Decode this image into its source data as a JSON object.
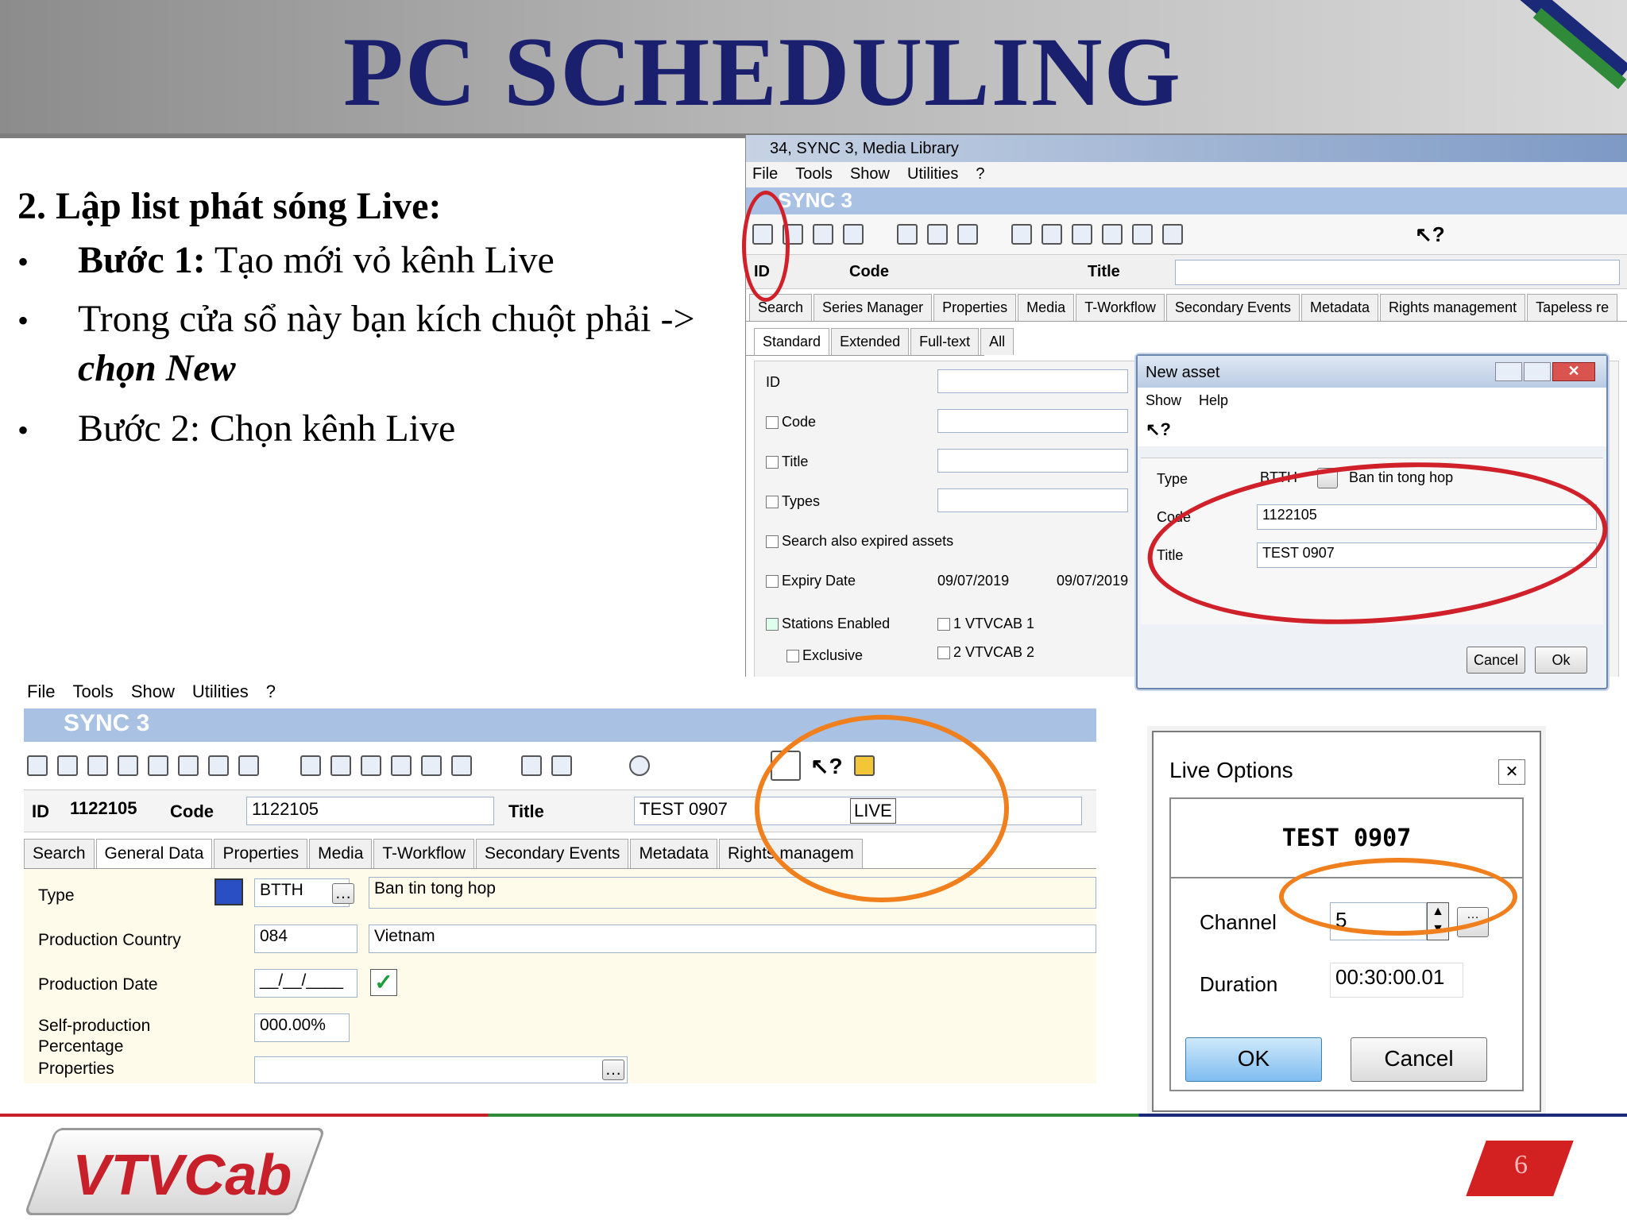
{
  "slide": {
    "title": "PC SCHEDULING",
    "heading": "2. Lập list phát sóng Live:",
    "bullets": [
      {
        "bold": "Bước 1:",
        "text": " Tạo mới vỏ kênh Live"
      },
      {
        "line1": "Trong cửa sổ này bạn kích chuột phải ->",
        "line2": "chọn New"
      },
      {
        "text": "Bước 2: Chọn kênh Live"
      }
    ],
    "page_number": "6",
    "logo_text": "VTVCab"
  },
  "win1": {
    "title": "34, SYNC 3, Media Library",
    "menu": [
      "File",
      "Tools",
      "Show",
      "Utilities",
      "?"
    ],
    "brand": "SYNC 3",
    "header": {
      "id": "ID",
      "code": "Code",
      "title": "Title"
    },
    "tabs": [
      "Search",
      "Series Manager",
      "Properties",
      "Media",
      "T-Workflow",
      "Secondary Events",
      "Metadata",
      "Rights management",
      "Tapeless re"
    ],
    "subtabs": [
      "Standard",
      "Extended",
      "Full-text",
      "All"
    ],
    "fields": {
      "id": "ID",
      "code": "Code",
      "title": "Title",
      "types": "Types",
      "search_expired": "Search also expired assets",
      "expiry_date": "Expiry Date",
      "date_from": "09/07/2019",
      "date_to": "09/07/2019",
      "stations_enabled": "Stations Enabled",
      "station1": "1 VTVCAB 1",
      "station2": "2 VTVCAB 2",
      "exclusive": "Exclusive"
    }
  },
  "new_asset": {
    "title": "New asset",
    "menu": [
      "Show",
      "Help"
    ],
    "type_label": "Type",
    "type_value": "BTTH",
    "type_desc": "Ban tin tong hop",
    "code_label": "Code",
    "code_value": "1122105",
    "title_label": "Title",
    "title_value": "TEST 0907",
    "cancel": "Cancel",
    "ok": "Ok"
  },
  "win2": {
    "menu": [
      "File",
      "Tools",
      "Show",
      "Utilities",
      "?"
    ],
    "brand": "SYNC 3",
    "id_label": "ID",
    "id_value": "1122105",
    "code_label": "Code",
    "code_value": "1122105",
    "title_label": "Title",
    "title_value": "TEST 0907",
    "live_badge": "LIVE",
    "tabs": [
      "Search",
      "General Data",
      "Properties",
      "Media",
      "T-Workflow",
      "Secondary Events",
      "Metadata",
      "Rights managem"
    ],
    "type_label": "Type",
    "type_value": "BTTH",
    "type_desc": "Ban tin tong hop",
    "country_label": "Production Country",
    "country_code": "084",
    "country_name": "Vietnam",
    "date_label": "Production Date",
    "date_value": "__/__/____",
    "self_label1": "Self-production",
    "self_label2": "Percentage",
    "self_value": "000.00%",
    "props_label": "Properties"
  },
  "live_options": {
    "title": "Live Options",
    "asset_title": "TEST 0907",
    "channel_label": "Channel",
    "channel_value": "5",
    "duration_label": "Duration",
    "duration_value": "00:30:00.01",
    "ok": "OK",
    "cancel": "Cancel"
  },
  "colors": {
    "title": "#1a1f6e",
    "annotation_red": "#d0202a",
    "annotation_orange": "#f07f1e",
    "sync_bar": "#a9c2e3"
  }
}
